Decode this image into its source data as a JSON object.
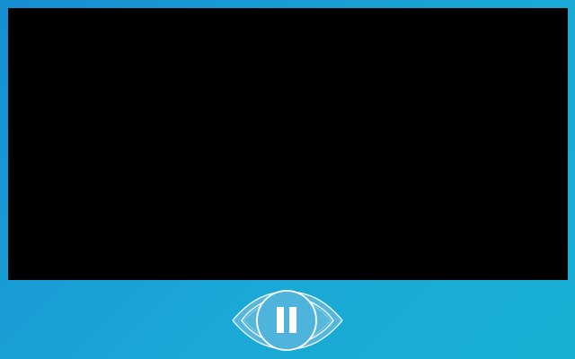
{
  "player": {
    "state": "playing",
    "control_icon": "pause-icon",
    "colors": {
      "frame_gradient_start": "#168fd2",
      "frame_gradient_end": "#18b0d2",
      "video_background": "#000000",
      "control_fill": "#5ab8dc",
      "control_outline": "#ffffff"
    }
  }
}
